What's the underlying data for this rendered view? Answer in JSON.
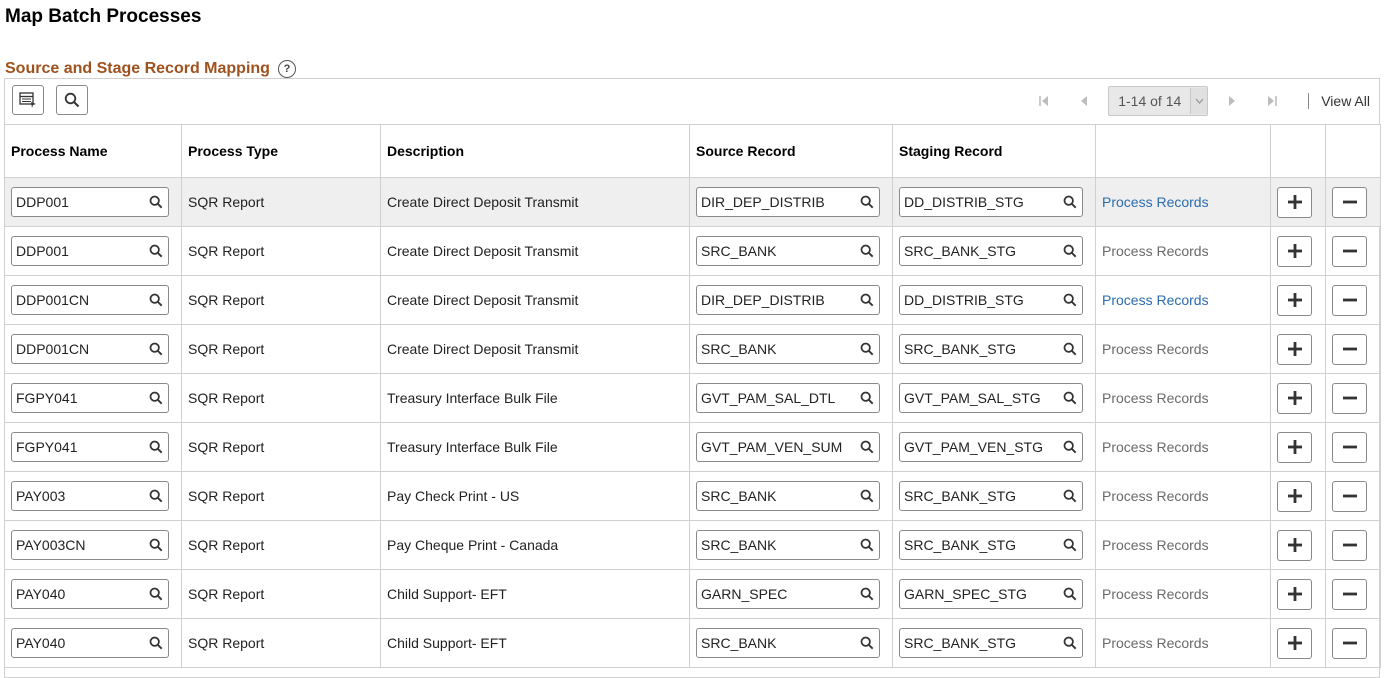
{
  "page": {
    "title": "Map Batch Processes"
  },
  "section": {
    "title": "Source and Stage Record Mapping",
    "help_icon": "question-circle-icon"
  },
  "toolbar": {
    "grid_options_icon": "grid-settings-icon",
    "find_icon": "search-icon"
  },
  "pager": {
    "first_icon": "first-page-icon",
    "prev_icon": "previous-page-icon",
    "range": "1-14 of 14",
    "next_icon": "next-page-icon",
    "last_icon": "last-page-icon",
    "view_all": "View All"
  },
  "columns": {
    "process_name": "Process Name",
    "process_type": "Process Type",
    "description": "Description",
    "source_record": "Source Record",
    "staging_record": "Staging Record"
  },
  "colors": {
    "section_title": "#a0521e",
    "link_active": "#2b6cb0",
    "link_disabled": "#6a6a6a",
    "selected_row": "#efefef"
  },
  "rows": [
    {
      "process_name": "DDP001",
      "process_type": "SQR Report",
      "description": "Create Direct Deposit Transmit",
      "source_record": "DIR_DEP_DISTRIB",
      "staging_record": "DD_DISTRIB_STG",
      "action": "Process Records",
      "action_enabled": true,
      "selected": true
    },
    {
      "process_name": "DDP001",
      "process_type": "SQR Report",
      "description": "Create Direct Deposit Transmit",
      "source_record": "SRC_BANK",
      "staging_record": "SRC_BANK_STG",
      "action": "Process Records",
      "action_enabled": false,
      "selected": false
    },
    {
      "process_name": "DDP001CN",
      "process_type": "SQR Report",
      "description": "Create Direct Deposit Transmit",
      "source_record": "DIR_DEP_DISTRIB",
      "staging_record": "DD_DISTRIB_STG",
      "action": "Process Records",
      "action_enabled": true,
      "selected": false
    },
    {
      "process_name": "DDP001CN",
      "process_type": "SQR Report",
      "description": "Create Direct Deposit Transmit",
      "source_record": "SRC_BANK",
      "staging_record": "SRC_BANK_STG",
      "action": "Process Records",
      "action_enabled": false,
      "selected": false
    },
    {
      "process_name": "FGPY041",
      "process_type": "SQR Report",
      "description": "Treasury Interface Bulk File",
      "source_record": "GVT_PAM_SAL_DTL",
      "staging_record": "GVT_PAM_SAL_STG",
      "action": "Process Records",
      "action_enabled": false,
      "selected": false
    },
    {
      "process_name": "FGPY041",
      "process_type": "SQR Report",
      "description": "Treasury Interface Bulk File",
      "source_record": "GVT_PAM_VEN_SUM",
      "staging_record": "GVT_PAM_VEN_STG",
      "action": "Process Records",
      "action_enabled": false,
      "selected": false
    },
    {
      "process_name": "PAY003",
      "process_type": "SQR Report",
      "description": "Pay Check Print - US",
      "source_record": "SRC_BANK",
      "staging_record": "SRC_BANK_STG",
      "action": "Process Records",
      "action_enabled": false,
      "selected": false
    },
    {
      "process_name": "PAY003CN",
      "process_type": "SQR Report",
      "description": "Pay Cheque Print - Canada",
      "source_record": "SRC_BANK",
      "staging_record": "SRC_BANK_STG",
      "action": "Process Records",
      "action_enabled": false,
      "selected": false
    },
    {
      "process_name": "PAY040",
      "process_type": "SQR Report",
      "description": "Child Support- EFT",
      "source_record": "GARN_SPEC",
      "staging_record": "GARN_SPEC_STG",
      "action": "Process Records",
      "action_enabled": false,
      "selected": false
    },
    {
      "process_name": "PAY040",
      "process_type": "SQR Report",
      "description": "Child Support- EFT",
      "source_record": "SRC_BANK",
      "staging_record": "SRC_BANK_STG",
      "action": "Process Records",
      "action_enabled": false,
      "selected": false
    }
  ]
}
